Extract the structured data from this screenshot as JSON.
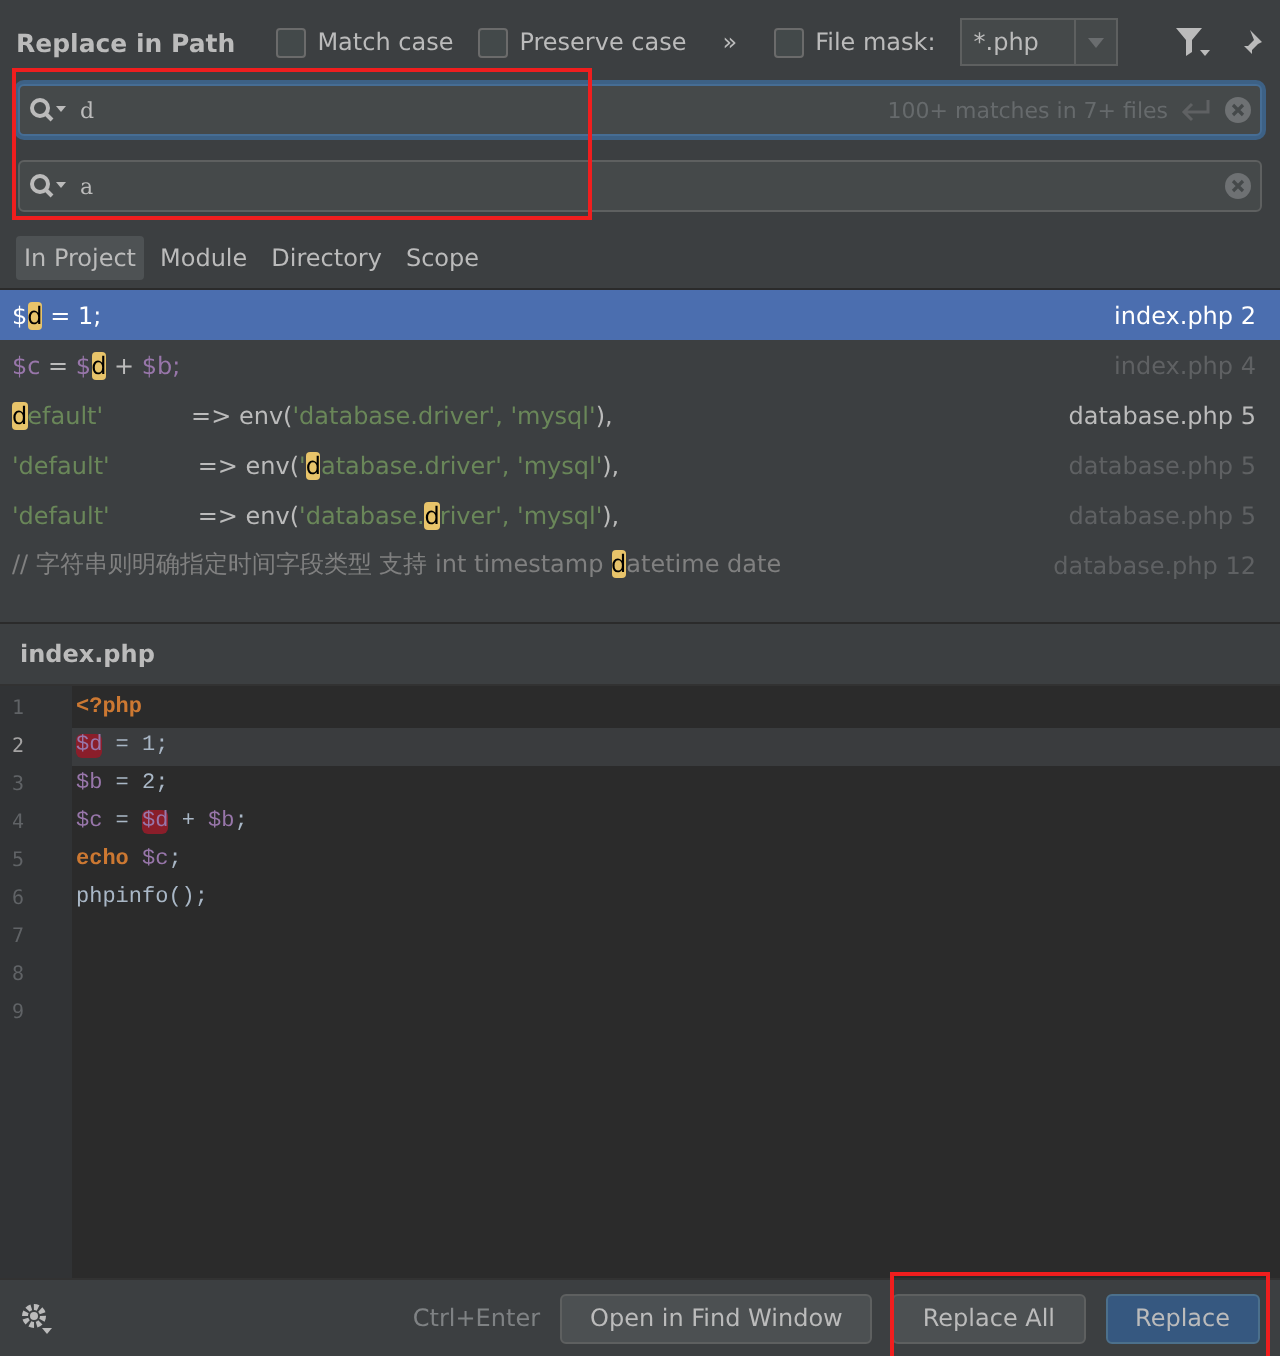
{
  "window": {
    "title": "Replace in Path"
  },
  "options": [
    {
      "label": "Match case",
      "checked": false
    },
    {
      "label": "Preserve case",
      "checked": false
    }
  ],
  "more": "»",
  "file_mask": {
    "label": "File mask:",
    "checked": false,
    "value": "*.php"
  },
  "search": {
    "value": "d",
    "status": "100+ matches in 7+ files"
  },
  "replace": {
    "value": "a"
  },
  "scopes": [
    {
      "label": "In Project",
      "selected": true
    },
    {
      "label": "Module",
      "selected": false
    },
    {
      "label": "Directory",
      "selected": false
    },
    {
      "label": "Scope",
      "selected": false
    }
  ],
  "results": [
    {
      "selected": true,
      "file": "index.php",
      "line": "2",
      "dim": false,
      "segments": [
        {
          "kind": "plain",
          "text": "$"
        },
        {
          "kind": "match",
          "text": "d"
        },
        {
          "kind": "plain",
          "text": " = 1;"
        }
      ]
    },
    {
      "selected": false,
      "file": "index.php",
      "line": "4",
      "dim": true,
      "segments": [
        {
          "kind": "var",
          "text": "$c"
        },
        {
          "kind": "plain",
          "text": " = "
        },
        {
          "kind": "var",
          "text": "$"
        },
        {
          "kind": "match",
          "text": "d"
        },
        {
          "kind": "plain",
          "text": " + "
        },
        {
          "kind": "var",
          "text": "$b;"
        }
      ]
    },
    {
      "selected": false,
      "file": "database.php",
      "line": "5",
      "dim": false,
      "segments": [
        {
          "kind": "match",
          "text": "d"
        },
        {
          "kind": "string",
          "text": "efault'"
        },
        {
          "kind": "gap",
          "text": "=> env("
        },
        {
          "kind": "string",
          "text": "'database.driver', 'mysql'"
        },
        {
          "kind": "plain",
          "text": "),"
        }
      ]
    },
    {
      "selected": false,
      "file": "database.php",
      "line": "5",
      "dim": true,
      "segments": [
        {
          "kind": "string",
          "text": "'default'"
        },
        {
          "kind": "gap",
          "text": "=> env("
        },
        {
          "kind": "string",
          "text": "'"
        },
        {
          "kind": "match",
          "text": "d"
        },
        {
          "kind": "string",
          "text": "atabase.driver', 'mysql'"
        },
        {
          "kind": "plain",
          "text": "),"
        }
      ]
    },
    {
      "selected": false,
      "file": "database.php",
      "line": "5",
      "dim": true,
      "segments": [
        {
          "kind": "string",
          "text": "'default'"
        },
        {
          "kind": "gap",
          "text": "=> env("
        },
        {
          "kind": "string",
          "text": "'database."
        },
        {
          "kind": "match",
          "text": "d"
        },
        {
          "kind": "string",
          "text": "river', 'mysql'"
        },
        {
          "kind": "plain",
          "text": "),"
        }
      ]
    },
    {
      "selected": false,
      "file": "database.php",
      "line": "12",
      "dim": true,
      "segments": [
        {
          "kind": "comment",
          "text": "// 字符串则明确指定时间字段类型 支持 int timestamp "
        },
        {
          "kind": "match",
          "text": "d"
        },
        {
          "kind": "comment",
          "text": "atetime date"
        }
      ]
    }
  ],
  "preview": {
    "file": "index.php",
    "line_numbers": [
      "1",
      "2",
      "3",
      "4",
      "5",
      "6",
      "7",
      "8",
      "9"
    ],
    "lines": [
      {
        "current": false,
        "tokens": [
          {
            "kind": "tag",
            "text": "<?php"
          }
        ]
      },
      {
        "current": true,
        "tokens": [
          {
            "kind": "hit",
            "text": "$d"
          },
          {
            "kind": "plain",
            "text": " = 1;"
          }
        ]
      },
      {
        "current": false,
        "tokens": [
          {
            "kind": "var",
            "text": "$b"
          },
          {
            "kind": "plain",
            "text": " = 2;"
          }
        ]
      },
      {
        "current": false,
        "tokens": [
          {
            "kind": "var",
            "text": "$c"
          },
          {
            "kind": "plain",
            "text": " = "
          },
          {
            "kind": "hit",
            "text": "$d"
          },
          {
            "kind": "plain",
            "text": " + "
          },
          {
            "kind": "var",
            "text": "$b"
          },
          {
            "kind": "plain",
            "text": ";"
          }
        ]
      },
      {
        "current": false,
        "tokens": [
          {
            "kind": "keyword",
            "text": "echo"
          },
          {
            "kind": "var",
            "text": "$c"
          },
          {
            "kind": "plain",
            "text": ";"
          }
        ]
      },
      {
        "current": false,
        "tokens": [
          {
            "kind": "plain",
            "text": "phpinfo();"
          }
        ]
      }
    ]
  },
  "footer": {
    "shortcut": "Ctrl+Enter",
    "buttons": [
      {
        "label": "Open in Find Window",
        "primary": false
      },
      {
        "label": "Replace All",
        "primary": false
      },
      {
        "label": "Replace",
        "primary": true
      }
    ]
  }
}
